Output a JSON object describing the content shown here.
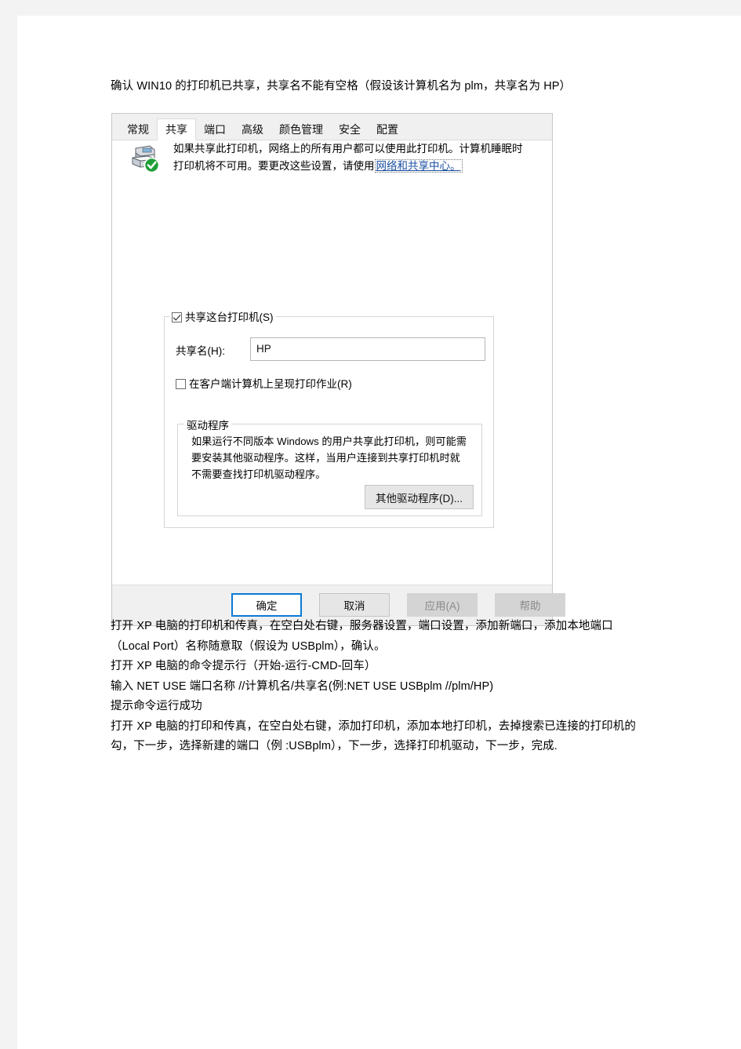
{
  "document": {
    "intro": "确认 WIN10 的打印机已共享，共享名不能有空格（假设该计算机名为 plm，共享名为 HP）",
    "steps": [
      "打开 XP 电脑的打印机和传真，在空白处右键，服务器设置，端口设置，添加新端口，添加本地端口（Local Port）名称随意取（假设为 USBplm），确认。",
      "打开 XP 电脑的命令提示行（开始-运行-CMD-回车）",
      "输入 NET USE  端口名称 //计算机名/共享名(例:NET USE USBplm //plm/HP)",
      "提示命令运行成功",
      "打开 XP 电脑的打印和传真，在空白处右键，添加打印机，添加本地打印机，去掉搜索已连接的打印机的勾，下一步，选择新建的端口（例 :USBplm），下一步，选择打印机驱动，下一步，完成."
    ]
  },
  "dialog": {
    "tabs": [
      {
        "label": "常规",
        "active": false
      },
      {
        "label": "共享",
        "active": true
      },
      {
        "label": "端口",
        "active": false
      },
      {
        "label": "高级",
        "active": false
      },
      {
        "label": "颜色管理",
        "active": false
      },
      {
        "label": "安全",
        "active": false
      },
      {
        "label": "配置",
        "active": false
      }
    ],
    "info": {
      "text_before": "如果共享此打印机，网络上的所有用户都可以使用此打印机。计算机睡眠时打印机将不可用。要更改这些设置，请使用",
      "link_label": "网络和共享中心。",
      "link_color": "#1a4fa0"
    },
    "share_group": {
      "share_checkbox_label": "共享这台打印机(S)",
      "share_checkbox_checked": true,
      "share_name_label": "共享名(H):",
      "share_name_value": "HP",
      "share_name_placeholder": "",
      "render_checkbox_label": "在客户端计算机上呈现打印作业(R)",
      "render_checkbox_checked": false
    },
    "driver_group": {
      "legend": "驱动程序",
      "text": "如果运行不同版本 Windows 的用户共享此打印机，则可能需要安装其他驱动程序。这样，当用户连接到共享打印机时就不需要查找打印机驱动程序。",
      "button_label": "其他驱动程序(D)..."
    },
    "footer": {
      "buttons": [
        {
          "label": "确定",
          "state": "default"
        },
        {
          "label": "取消",
          "state": "normal"
        },
        {
          "label": "应用(A)",
          "state": "disabled"
        },
        {
          "label": "帮助",
          "state": "disabled"
        }
      ]
    },
    "icons": {
      "printer": "printer-shared-icon",
      "check_badge": "green-check-badge-icon"
    }
  }
}
